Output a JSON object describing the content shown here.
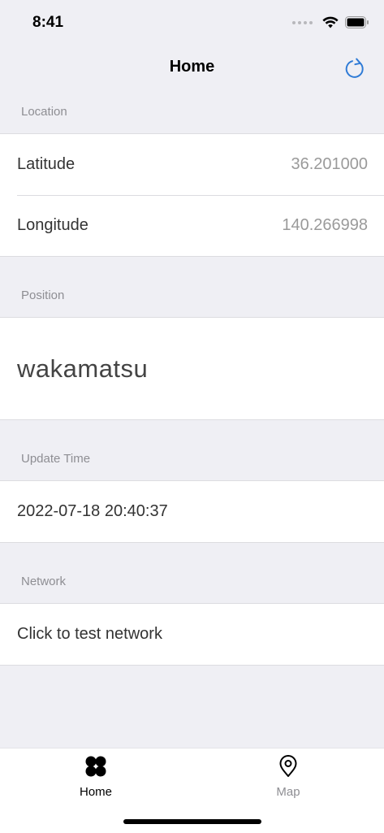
{
  "status_bar": {
    "time": "8:41"
  },
  "nav": {
    "title": "Home"
  },
  "sections": {
    "location": {
      "header": "Location",
      "rows": [
        {
          "label": "Latitude",
          "value": "36.201000"
        },
        {
          "label": "Longitude",
          "value": "140.266998"
        }
      ]
    },
    "position": {
      "header": "Position",
      "value": "wakamatsu"
    },
    "update_time": {
      "header": "Update Time",
      "value": "2022-07-18 20:40:37"
    },
    "network": {
      "header": "Network",
      "action_label": "Click to test network"
    }
  },
  "tab_bar": {
    "tabs": [
      {
        "label": "Home",
        "icon": "grid-clover-icon",
        "active": true,
        "color": "#000000"
      },
      {
        "label": "Map",
        "icon": "location-pin-icon",
        "active": false,
        "color": "#8e8e93"
      }
    ]
  },
  "colors": {
    "accent": "#2f7bd6",
    "background": "#efeff4"
  }
}
